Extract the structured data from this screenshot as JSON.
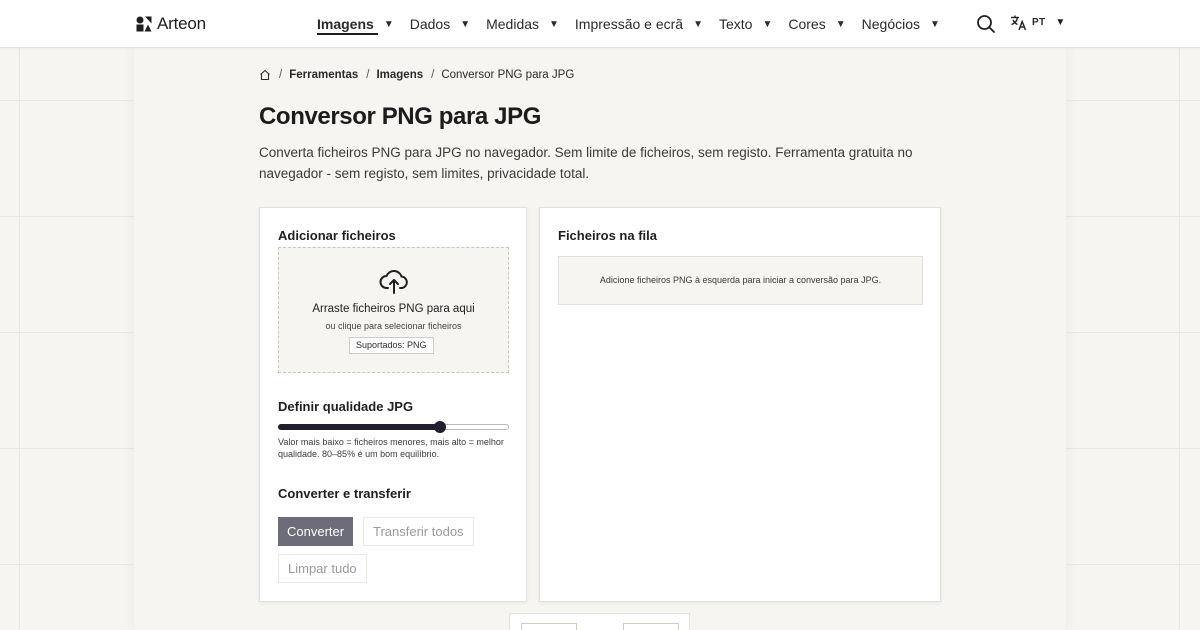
{
  "header": {
    "logo_text": "Arteon",
    "nav": [
      {
        "label": "Imagens",
        "active": true
      },
      {
        "label": "Dados",
        "active": false
      },
      {
        "label": "Medidas",
        "active": false
      },
      {
        "label": "Impressão e ecrã",
        "active": false
      },
      {
        "label": "Texto",
        "active": false
      },
      {
        "label": "Cores",
        "active": false
      },
      {
        "label": "Negócios",
        "active": false
      }
    ],
    "language": "PT"
  },
  "breadcrumb": {
    "items": [
      "Ferramentas",
      "Imagens",
      "Conversor PNG para JPG"
    ],
    "separator": "/"
  },
  "page": {
    "title": "Conversor PNG para JPG",
    "description": "Converta ficheiros PNG para JPG no navegador. Sem limite de ficheiros, sem registo. Ferramenta gratuita no navegador - sem registo, sem limites, privacidade total."
  },
  "upload": {
    "heading": "Adicionar ficheiros",
    "drop_title": "Arraste ficheiros PNG para aqui",
    "drop_subtitle": "ou clique para selecionar ficheiros",
    "supported": "Suportados: PNG"
  },
  "quality": {
    "heading": "Definir qualidade JPG",
    "value_fraction": 0.7,
    "hint": "Valor mais baixo = ficheiros menores, mais alto = melhor qualidade. 80–85% é um bom equilíbrio."
  },
  "actions": {
    "heading": "Converter e transferir",
    "convert": "Converter",
    "download_all": "Transferir todos",
    "clear_all": "Limpar tudo"
  },
  "queue": {
    "heading": "Ficheiros na fila",
    "empty_message": "Adicione ficheiros PNG à esquerda para iniciar a conversão para JPG."
  },
  "colors": {
    "accent": "#1f1f2e",
    "primary_button": "#6d6d7a",
    "background": "#f7f5f2"
  }
}
